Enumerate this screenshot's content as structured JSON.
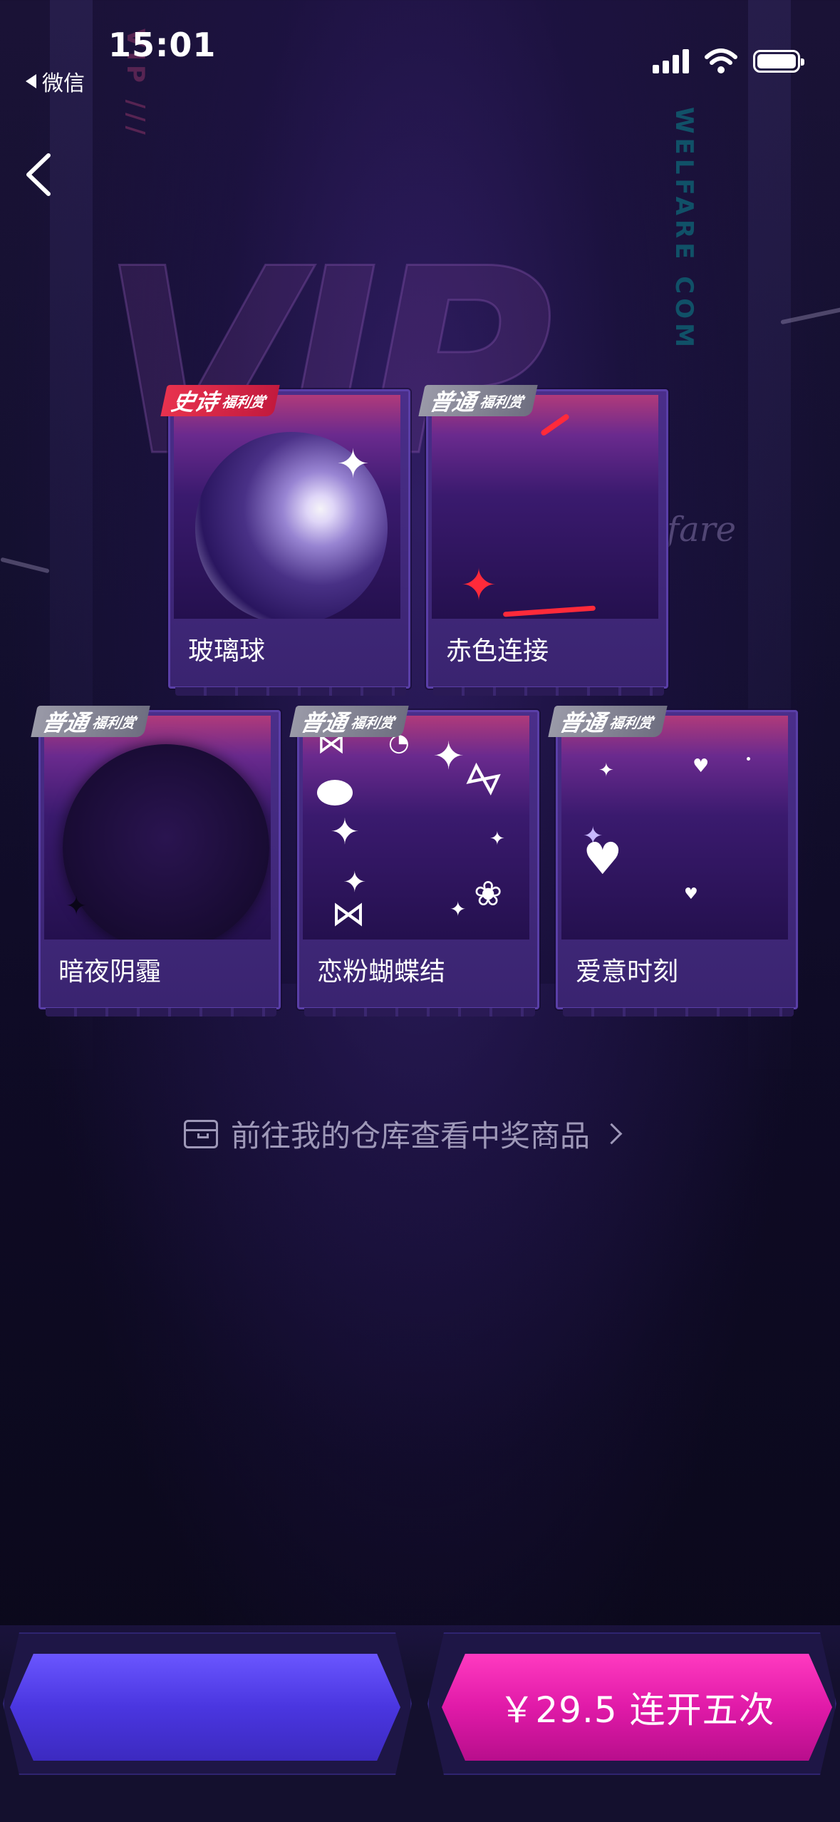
{
  "status_bar": {
    "time": "15:01",
    "back_app": "微信",
    "icons": [
      "signal-icon",
      "wifi-icon",
      "battery-icon"
    ]
  },
  "nav": {
    "back_icon": "chevron-left-icon"
  },
  "prizes": [
    {
      "name": "玻璃球",
      "badge_main": "史诗",
      "badge_sub": "福利赏",
      "tier": "epic"
    },
    {
      "name": "赤色连接",
      "badge_main": "普通",
      "badge_sub": "福利赏",
      "tier": "normal"
    },
    {
      "name": "暗夜阴霾",
      "badge_main": "普通",
      "badge_sub": "福利赏",
      "tier": "normal"
    },
    {
      "name": "恋粉蝴蝶结",
      "badge_main": "普通",
      "badge_sub": "福利赏",
      "tier": "normal"
    },
    {
      "name": "爱意时刻",
      "badge_main": "普通",
      "badge_sub": "福利赏",
      "tier": "normal"
    }
  ],
  "warehouse_link": "前往我的仓库查看中奖商品",
  "buttons": {
    "left_label": "",
    "right_label": "￥29.5 连开五次"
  },
  "colors": {
    "epic_badge": "#e8324e",
    "normal_badge": "#8a8a98",
    "left_button": "#5a46f0",
    "right_button": "#e01aa8"
  }
}
